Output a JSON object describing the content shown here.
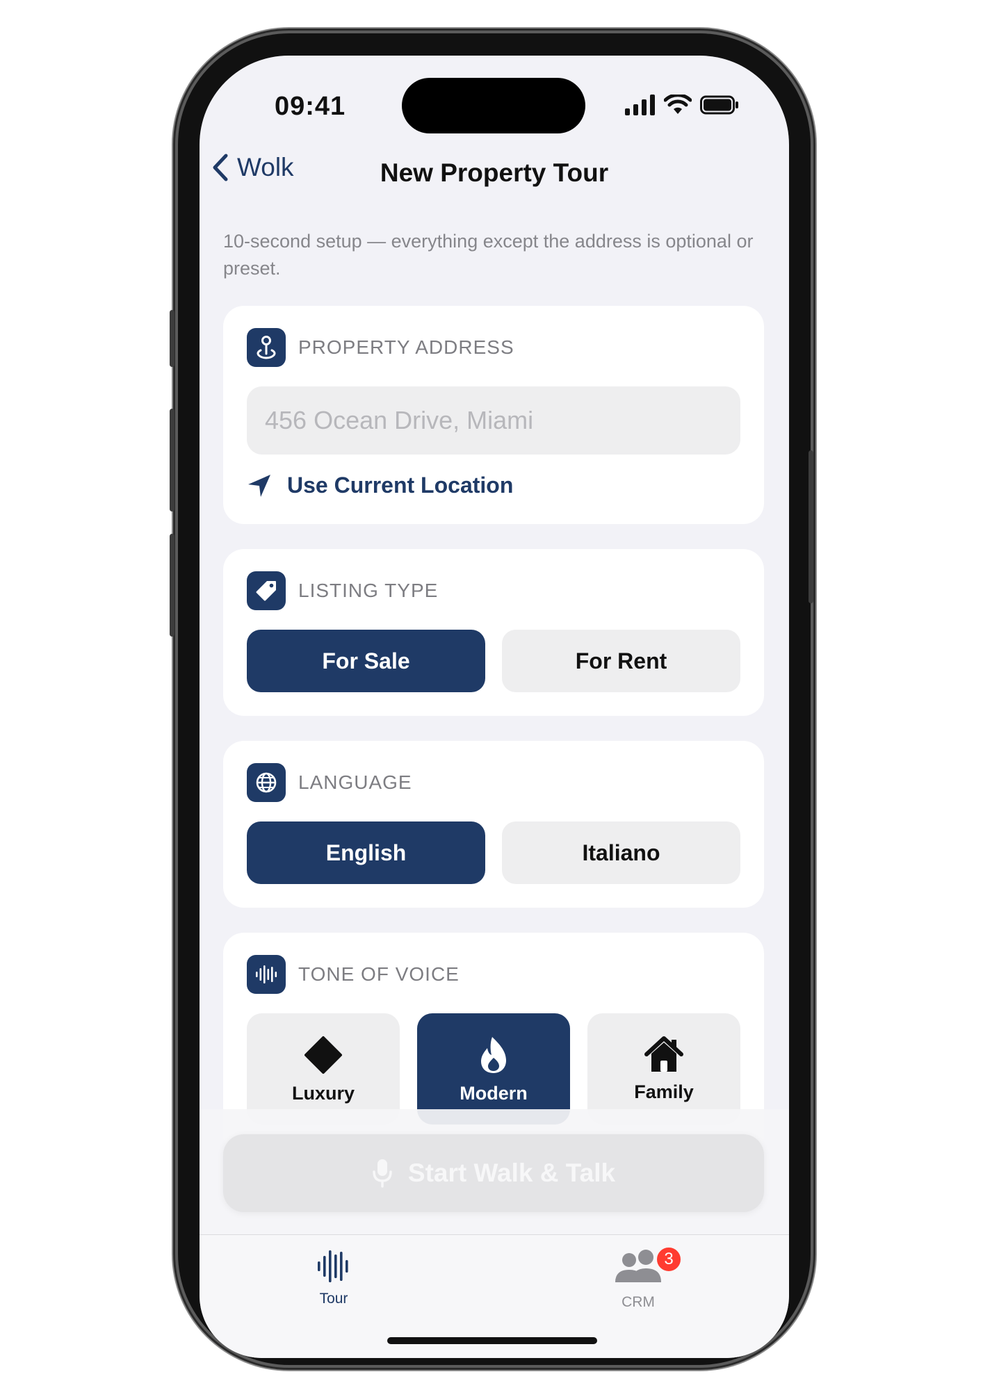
{
  "status_bar": {
    "time": "09:41",
    "icons": [
      "cellular-signal-icon",
      "wifi-icon",
      "battery-icon"
    ]
  },
  "nav": {
    "back_label": "Wolk",
    "title": "New Property Tour"
  },
  "subtitle": "10-second setup — everything except the address is optional or preset.",
  "address": {
    "title": "PROPERTY ADDRESS",
    "input_value": "",
    "placeholder": "456 Ocean Drive, Miami",
    "location_label": "Use Current Location"
  },
  "listing_type": {
    "title": "LISTING TYPE",
    "options": [
      "For Sale",
      "For Rent"
    ],
    "selected": "For Sale"
  },
  "language": {
    "title": "LANGUAGE",
    "options": [
      "English",
      "Italiano"
    ],
    "selected": "English"
  },
  "tone": {
    "title": "TONE OF VOICE",
    "options": [
      {
        "label": "Luxury",
        "icon": "diamond-icon"
      },
      {
        "label": "Modern",
        "icon": "flame-icon"
      },
      {
        "label": "Family",
        "icon": "house-icon"
      }
    ],
    "selected": "Modern"
  },
  "cta": {
    "label": "Start Walk & Talk",
    "icon": "microphone-icon",
    "enabled": false
  },
  "tabs": [
    {
      "label": "Tour",
      "icon": "waveform-icon",
      "active": true
    },
    {
      "label": "CRM",
      "icon": "people-icon",
      "active": false,
      "badge": "3"
    }
  ],
  "colors": {
    "accent": "#1f3a66",
    "background": "#f2f2f7",
    "card": "#ffffff",
    "badge": "#ff3b30",
    "inactive_tab": "#8e8e93"
  }
}
